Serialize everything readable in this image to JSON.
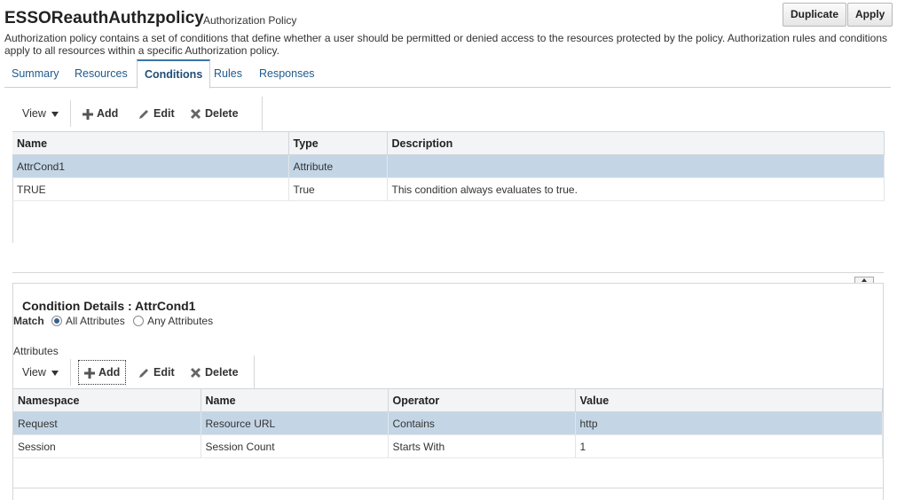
{
  "header": {
    "title": "ESSOReauthAuthzpolicy",
    "subtitle": "Authorization Policy",
    "duplicate_label": "Duplicate",
    "apply_label": "Apply",
    "description": "Authorization policy contains a set of conditions that define whether a user should be permitted or denied access to the resources protected by the policy. Authorization rules and conditions apply to all resources within a specific Authorization policy."
  },
  "tabs": [
    {
      "label": "Summary"
    },
    {
      "label": "Resources"
    },
    {
      "label": "Conditions",
      "active": true
    },
    {
      "label": "Rules"
    },
    {
      "label": "Responses"
    }
  ],
  "conditions_toolbar": {
    "view_label": "View",
    "add_label": "Add",
    "edit_label": "Edit",
    "delete_label": "Delete"
  },
  "conditions_table": {
    "columns": [
      "Name",
      "Type",
      "Description"
    ],
    "rows": [
      {
        "name": "AttrCond1",
        "type": "Attribute",
        "description": "",
        "selected": true
      },
      {
        "name": "TRUE",
        "type": "True",
        "description": "This condition always evaluates to true.",
        "selected": false
      }
    ]
  },
  "condition_details": {
    "title": "Condition Details : AttrCond1",
    "match_label": "Match",
    "all_attributes_label": "All Attributes",
    "any_attributes_label": "Any Attributes",
    "selected_match": "All Attributes",
    "attributes_label": "Attributes"
  },
  "attributes_toolbar": {
    "view_label": "View",
    "add_label": "Add",
    "edit_label": "Edit",
    "delete_label": "Delete"
  },
  "attributes_table": {
    "columns": [
      "Namespace",
      "Name",
      "Operator",
      "Value"
    ],
    "rows": [
      {
        "namespace": "Request",
        "name": "Resource URL",
        "operator": "Contains",
        "value": "http",
        "selected": true
      },
      {
        "namespace": "Session",
        "name": "Session Count",
        "operator": "Starts With",
        "value": "1",
        "selected": false
      }
    ]
  },
  "colors": {
    "accent": "#3c74a5",
    "link": "#1f5a8c",
    "selected_row": "#c4d6e6",
    "header_bg": "#f2f4f6"
  },
  "icons": {
    "add": "plus-icon",
    "edit": "pencil-icon",
    "delete": "x-icon",
    "view": "dropdown-triangle-icon",
    "collapse": "collapse-up-icon"
  }
}
